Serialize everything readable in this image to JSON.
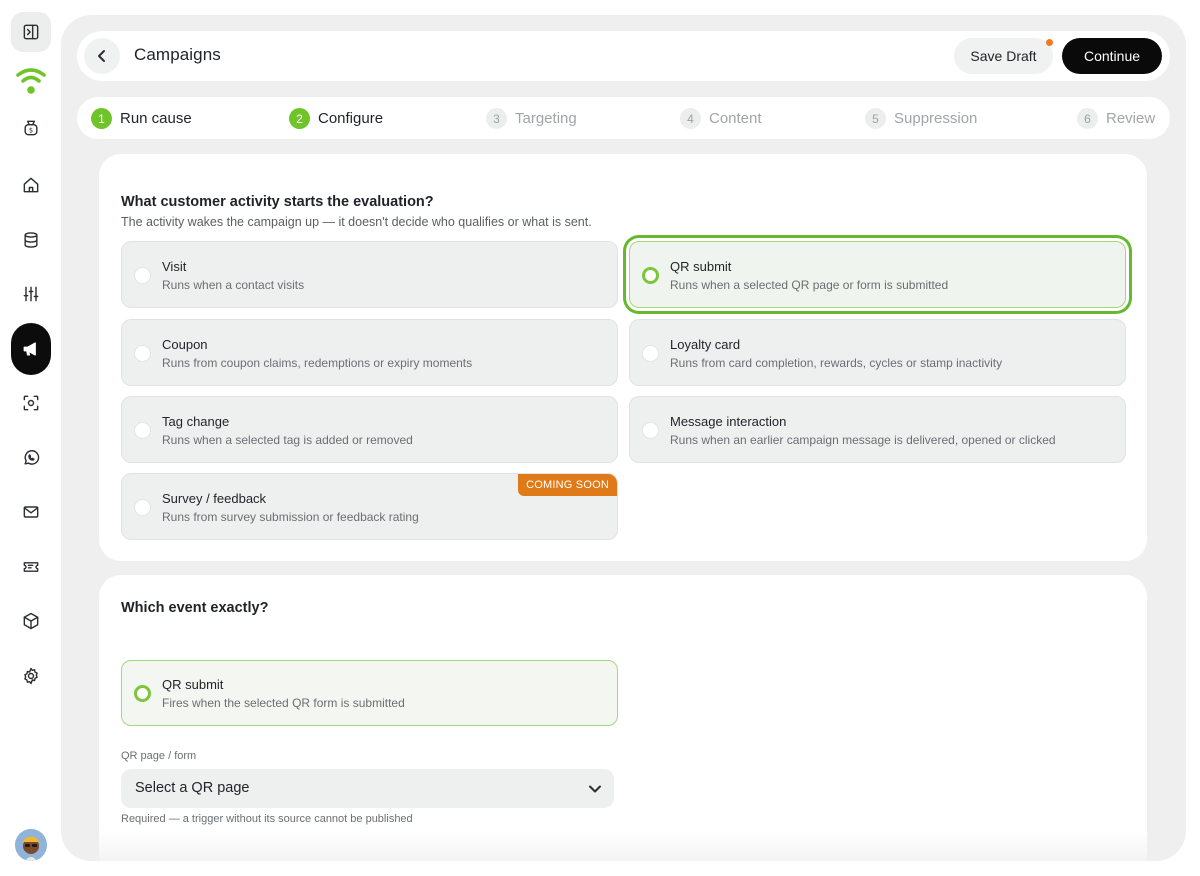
{
  "header": {
    "title": "Campaigns",
    "save_draft_label": "Save Draft",
    "continue_label": "Continue"
  },
  "stepper": {
    "steps": [
      {
        "number": "1",
        "label": "Run cause",
        "state": "done"
      },
      {
        "number": "2",
        "label": "Configure",
        "state": "done"
      },
      {
        "number": "3",
        "label": "Targeting",
        "state": "todo"
      },
      {
        "number": "4",
        "label": "Content",
        "state": "todo"
      },
      {
        "number": "5",
        "label": "Suppression",
        "state": "todo"
      },
      {
        "number": "6",
        "label": "Review",
        "state": "todo"
      }
    ]
  },
  "activity": {
    "title": "What customer activity starts the evaluation?",
    "subtitle": "The activity wakes the campaign up — it doesn't decide who qualifies or what is sent.",
    "options": [
      {
        "title": "Visit",
        "description": "Runs when a contact visits",
        "selected": false
      },
      {
        "title": "QR submit",
        "description": "Runs when a selected QR page or form is submitted",
        "selected": true
      },
      {
        "title": "Coupon",
        "description": "Runs from coupon claims, redemptions or expiry moments",
        "selected": false
      },
      {
        "title": "Loyalty card",
        "description": "Runs from card completion, rewards, cycles or stamp inactivity",
        "selected": false
      },
      {
        "title": "Tag change",
        "description": "Runs when a selected tag is added or removed",
        "selected": false
      },
      {
        "title": "Message interaction",
        "description": "Runs when an earlier campaign message is delivered, opened or clicked",
        "selected": false
      },
      {
        "title": "Survey / feedback",
        "description": "Runs from survey submission or feedback rating",
        "selected": false,
        "badge": "COMING SOON"
      }
    ]
  },
  "event": {
    "title": "Which event exactly?",
    "option": {
      "title": "QR submit",
      "description": "Fires when the selected QR form is submitted",
      "selected": true
    },
    "field_label": "QR page / form",
    "select_value": "Select a QR page",
    "help_text": "Required — a trigger without its source cannot be published"
  },
  "colors": {
    "accent": "#6fc42a",
    "selected_outline": "#66b82f",
    "badge": "#e07a19",
    "notification_dot": "#f07a22",
    "primary_button": "#0a0a0a"
  },
  "sidebar_icons": [
    "sidebar-toggle-icon",
    "wifi-logo-icon",
    "money-bag-icon",
    "home-icon",
    "database-icon",
    "sliders-icon",
    "megaphone-icon",
    "scan-icon",
    "whatsapp-icon",
    "mail-icon",
    "ticket-icon",
    "box-icon",
    "gear-icon"
  ]
}
